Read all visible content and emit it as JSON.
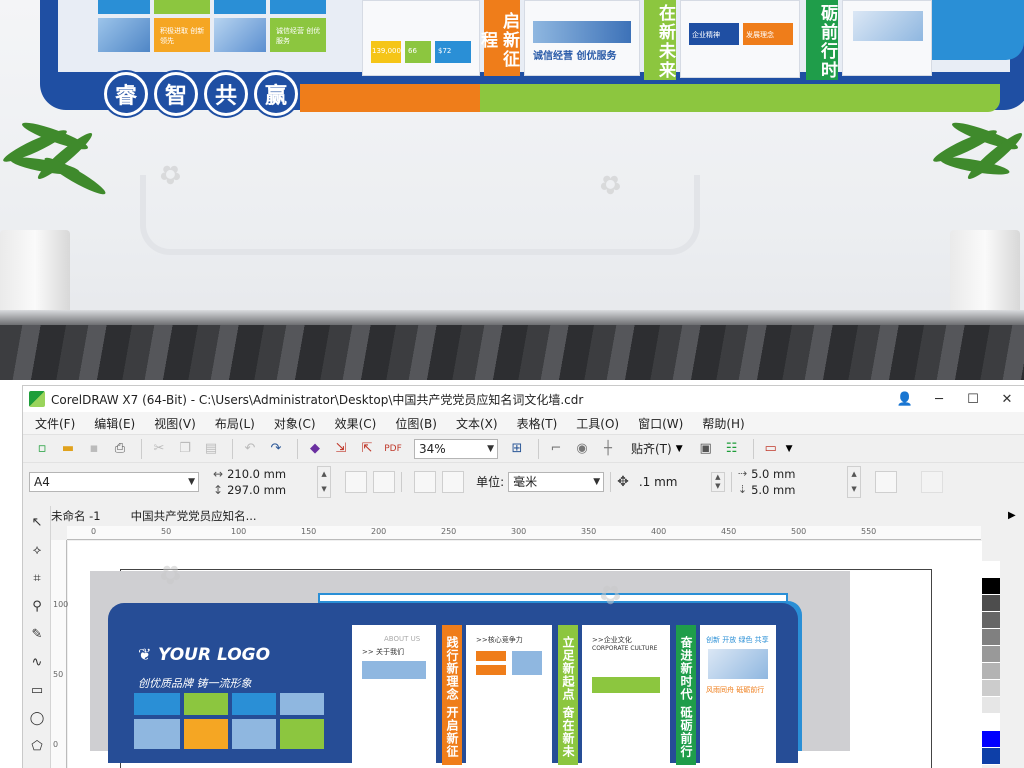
{
  "scene": {
    "circle_chars": [
      "睿",
      "智",
      "共",
      "赢"
    ],
    "vbar_texts": [
      "启新征程",
      "在新未来",
      "砺前行时"
    ],
    "panel_captions": [
      "诚信经营 创优服务",
      "企业精神",
      "发展理念"
    ],
    "small_tiles": [
      "积极进取 创新领先",
      "诚信经营 创优服务"
    ],
    "stat_numbers": [
      "139,000",
      "66",
      "$72"
    ],
    "colors": {
      "brand_blue": "#1f4fa3",
      "accent_orange": "#ef7d1a",
      "accent_green": "#8cc63f",
      "sky_blue": "#2a8fd6"
    }
  },
  "window": {
    "title": "CorelDRAW X7 (64-Bit) - C:\\Users\\Administrator\\Desktop\\中国共产党党员应知名词文化墙.cdr",
    "buttons": {
      "minimize": "─",
      "maximize": "☐",
      "close": "✕"
    },
    "user_icon": "user-icon"
  },
  "menu": [
    "文件(F)",
    "编辑(E)",
    "视图(V)",
    "布局(L)",
    "对象(C)",
    "效果(C)",
    "位图(B)",
    "文本(X)",
    "表格(T)",
    "工具(O)",
    "窗口(W)",
    "帮助(H)"
  ],
  "toolbar": {
    "zoom": "34%",
    "snap_label": "贴齐(T)"
  },
  "propbar": {
    "page_size": "A4",
    "width": "210.0 mm",
    "height": "297.0 mm",
    "unit_label": "单位:",
    "unit_value": "毫米",
    "nudge": ".1 mm",
    "dup_x": "5.0 mm",
    "dup_y": "5.0 mm"
  },
  "doc_tabs": [
    "未命名 -1",
    "中国共产党党员应知名..."
  ],
  "ruler_h": [
    "0",
    "50",
    "100",
    "150",
    "200",
    "250",
    "300",
    "350",
    "400",
    "450",
    "500",
    "550"
  ],
  "ruler_v": [
    "100",
    "50",
    "0"
  ],
  "artwork": {
    "logo": "YOUR LOGO",
    "slogan": "创优质品牌  铸一流形象",
    "columns": [
      {
        "title": "ABOUT US",
        "sub": ">> 关于我们"
      },
      {
        "title": ">>核心竞争力",
        "sub": ""
      },
      {
        "title": ">>企业文化",
        "sub": "CORPORATE CULTURE"
      },
      {
        "title": "创新 开放 绿色 共享",
        "sub": "风雨同舟 砥砺前行"
      }
    ],
    "vbars": [
      "践行新理念 开启新征",
      "立足新起点 奋在新未",
      "奋进新时代 砥砺前行"
    ]
  },
  "palette": [
    "#ffffff",
    "#000000",
    "#4d4d4d",
    "#666666",
    "#808080",
    "#999999",
    "#b3b3b3",
    "#cccccc",
    "#e6e6e6",
    "#ffffff",
    "#0000ff",
    "#0d3fa8"
  ]
}
